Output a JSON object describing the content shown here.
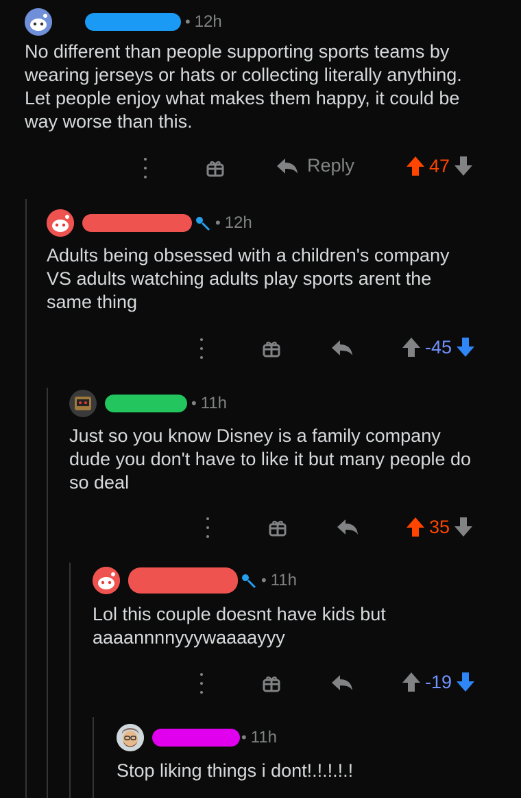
{
  "comments": [
    {
      "time": "12h",
      "body": [
        "No different than people supporting sports teams by",
        "wearing jerseys or hats or collecting literally anything.",
        "Let people enjoy what makes them happy, it could be",
        "way worse than this."
      ],
      "reply_label": "Reply",
      "score": "47",
      "vote_state": "upvoted",
      "redaction_color": "#1a9af5"
    },
    {
      "time": "12h",
      "body": [
        "Adults being obsessed with a children's company",
        "VS adults watching adults play sports arent the",
        "same thing"
      ],
      "score": "-45",
      "vote_state": "downvoted",
      "redaction_color": "#ef5350"
    },
    {
      "time": "11h",
      "body": [
        "Just so you know Disney is a family company",
        "dude you don't have to like it but many people do",
        "so deal"
      ],
      "score": "35",
      "vote_state": "upvoted",
      "redaction_color": "#22c55e"
    },
    {
      "time": "11h",
      "body": [
        "Lol this couple doesnt have kids but",
        "aaaannnnyyywaaaayyy"
      ],
      "score": "-19",
      "vote_state": "downvoted",
      "redaction_color": "#ef5350"
    },
    {
      "time": "11h",
      "body": [
        "Stop liking things i dont!.!.!.!.!"
      ],
      "redaction_color": "#e000ee"
    }
  ],
  "colors": {
    "upvote": "#ff4500",
    "downvote": "#7193ff",
    "muted": "#818384",
    "text": "#d7dadc"
  },
  "icons": [
    "snoo-avatar-icon",
    "mic-icon",
    "kebab-menu-icon",
    "gift-award-icon",
    "reply-arrow-icon",
    "upvote-arrow-icon",
    "downvote-arrow-icon"
  ]
}
